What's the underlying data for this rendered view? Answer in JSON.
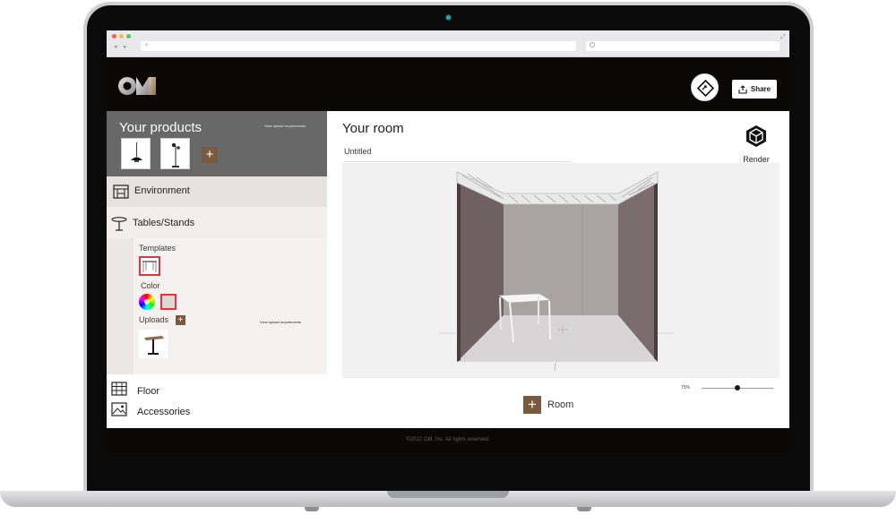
{
  "header": {
    "logo_text": "OM",
    "share_label": "Share"
  },
  "sidebar": {
    "products": {
      "title": "Your products",
      "upload_requirements": "View upload requirements",
      "add_label": "+"
    },
    "environment_label": "Environment",
    "tables": {
      "label": "Tables/Stands",
      "templates_label": "Templates",
      "color_label": "Color",
      "uploads_label": "Uploads",
      "add_label": "+",
      "upload_requirements": "View upload requirements"
    },
    "floor_label": "Floor",
    "accessories_label": "Accessories"
  },
  "room": {
    "title": "Your room",
    "name": "Untitled",
    "render_label": "Render",
    "zoom": "75%",
    "zoom_fraction": 0.5,
    "add_room_label": "Room",
    "add_label": "+"
  },
  "footer": {
    "text": "©2022 OM, Inc. All rights reserved."
  },
  "colors": {
    "header_bg": "#0a0707",
    "products_bg": "#686868",
    "accent_brown": "#7a5a3f",
    "selected_border": "#e0373f"
  }
}
